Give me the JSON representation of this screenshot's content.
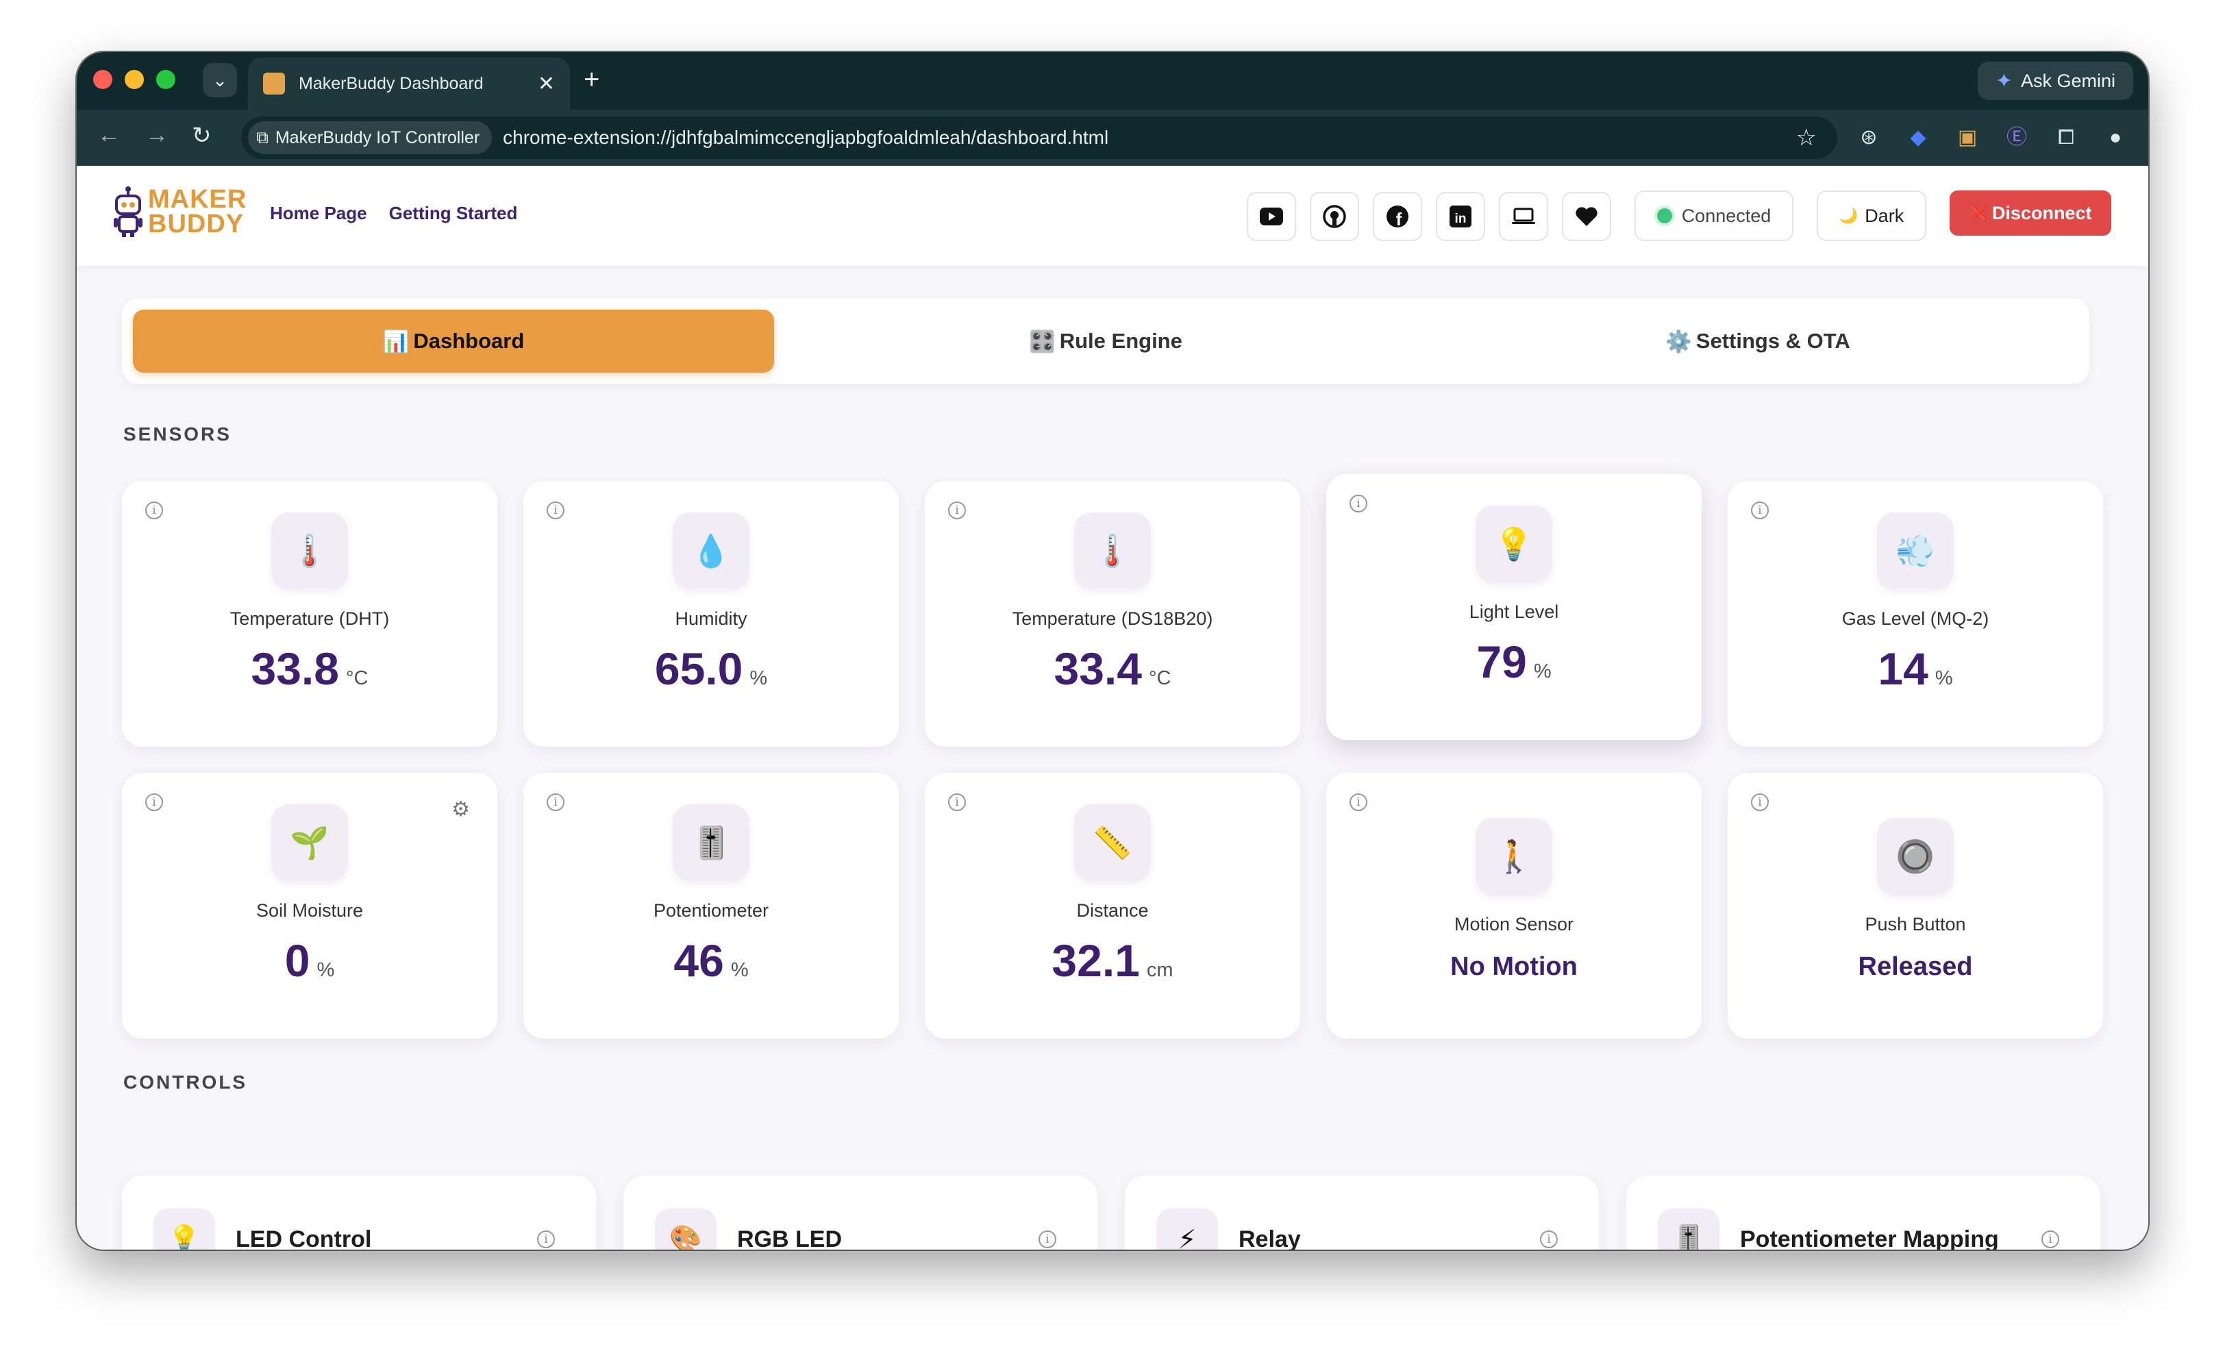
{
  "browser": {
    "tab_title": "MakerBuddy Dashboard",
    "favicon_text": "MAKER BUDDY",
    "new_tab": "+",
    "close": "✕",
    "menu": "⌄",
    "gemini_label": "Ask Gemini",
    "url_chip": "MakerBuddy IoT Controller",
    "url": "chrome-extension://jdhfgbalmimccengljapbgfoaldmleah/dashboard.html"
  },
  "app": {
    "logo_line1": "MAKER",
    "logo_line2": "BUDDY",
    "nav": [
      "Home Page",
      "Getting Started"
    ],
    "social_icons": [
      "youtube-icon",
      "github-icon",
      "facebook-icon",
      "linkedin-icon",
      "laptop-icon",
      "heart-icon"
    ],
    "status": "Connected",
    "theme_label": "Dark",
    "theme_icon": "🌙",
    "disconnect_label": "Disconnect",
    "disconnect_icon": "❌",
    "accent": "#e99c3f",
    "brand_purple": "#3d1f6e",
    "danger": "#e04848",
    "status_color": "#3cc47c"
  },
  "tabs": [
    {
      "icon": "📊",
      "label": "Dashboard",
      "active": true
    },
    {
      "icon": "🎛️",
      "label": "Rule Engine",
      "active": false
    },
    {
      "icon": "⚙️",
      "label": "Settings & OTA",
      "active": false
    }
  ],
  "sections": {
    "sensors": "SENSORS",
    "controls": "CONTROLS"
  },
  "sensors": [
    {
      "icon": "🌡️",
      "name": "Temperature (DHT)",
      "value": "33.8",
      "unit": "°C"
    },
    {
      "icon": "💧",
      "name": "Humidity",
      "value": "65.0",
      "unit": "%"
    },
    {
      "icon": "🌡️",
      "name": "Temperature (DS18B20)",
      "value": "33.4",
      "unit": "°C"
    },
    {
      "icon": "💡",
      "name": "Light Level",
      "value": "79",
      "unit": "%"
    },
    {
      "icon": "💨",
      "name": "Gas Level (MQ-2)",
      "value": "14",
      "unit": "%"
    },
    {
      "icon": "🌱",
      "name": "Soil Moisture",
      "value": "0",
      "unit": "%"
    },
    {
      "icon": "🎚️",
      "name": "Potentiometer",
      "value": "46",
      "unit": "%"
    },
    {
      "icon": "📏",
      "name": "Distance",
      "value": "32.1",
      "unit": "cm"
    },
    {
      "icon": "🚶",
      "name": "Motion Sensor",
      "state": "No Motion"
    },
    {
      "icon": "🔘",
      "name": "Push Button",
      "state": "Released"
    }
  ],
  "controls": [
    {
      "icon": "💡",
      "title": "LED Control"
    },
    {
      "icon": "🎨",
      "title": "RGB LED"
    },
    {
      "icon": "⚡",
      "title": "Relay"
    },
    {
      "icon": "🎚️",
      "title": "Potentiometer Mapping"
    }
  ]
}
